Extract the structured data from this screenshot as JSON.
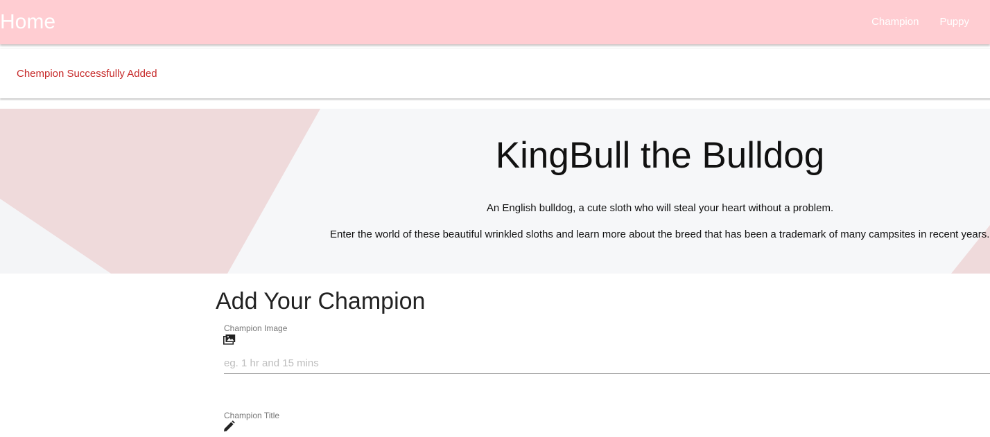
{
  "navbar": {
    "brand": "Home",
    "links": [
      "Champion",
      "Puppy"
    ],
    "background_color": "#ffcdd2"
  },
  "flash": {
    "message": "Chempion Successfully Added",
    "color": "#c62828"
  },
  "hero": {
    "title": "KingBull the Bulldog",
    "paragraph1": "An English bulldog, a cute sloth who will steal your heart without a problem.",
    "paragraph2": "Enter the world of these beautiful wrinkled sloths and learn more about the breed that has been a trademark of many campsites in recent years.",
    "background_color": "#f6f7f9",
    "accent_color": "#efdadb"
  },
  "form": {
    "title": "Add Your Champion",
    "fields": [
      {
        "label": "Champion Image",
        "icon": "image-icon",
        "placeholder": "eg. 1 hr and 15 mins",
        "value": ""
      },
      {
        "label": "Champion Title",
        "icon": "pencil-icon"
      }
    ]
  }
}
